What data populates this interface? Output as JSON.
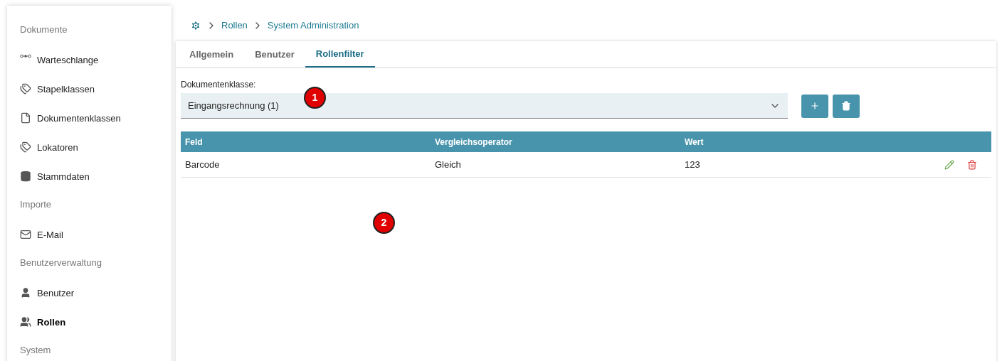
{
  "sidebar": {
    "items": [
      {
        "kind": "section",
        "label": "Dokumente"
      },
      {
        "kind": "link",
        "label": "Warteschlange",
        "selected": false
      },
      {
        "kind": "link",
        "label": "Stapelklassen",
        "selected": false
      },
      {
        "kind": "link",
        "label": "Dokumentenklassen",
        "selected": false
      },
      {
        "kind": "link",
        "label": "Lokatoren",
        "selected": false
      },
      {
        "kind": "link",
        "label": "Stammdaten",
        "selected": false
      },
      {
        "kind": "section",
        "label": "Importe"
      },
      {
        "kind": "link",
        "label": "E-Mail",
        "selected": false
      },
      {
        "kind": "section",
        "label": "Benutzerverwaltung"
      },
      {
        "kind": "link",
        "label": "Benutzer",
        "selected": false
      },
      {
        "kind": "link",
        "label": "Rollen",
        "selected": true
      },
      {
        "kind": "section",
        "label": "System"
      }
    ]
  },
  "breadcrumb": [
    "Rollen",
    "System Administration"
  ],
  "tabs": [
    {
      "label": "Allgemein",
      "selected": false
    },
    {
      "label": "Benutzer",
      "selected": false
    },
    {
      "label": "Rollenfilter",
      "selected": true
    }
  ],
  "select": {
    "label": "Dokumentenklasse:",
    "value": "Eingangsrechnung (1)"
  },
  "table": {
    "columns": [
      "Feld",
      "Vergleichsoperator",
      "Wert"
    ],
    "rows": [
      {
        "cells": [
          "Barcode",
          "Gleich",
          "123"
        ]
      }
    ]
  },
  "callouts": [
    "1",
    "2"
  ]
}
